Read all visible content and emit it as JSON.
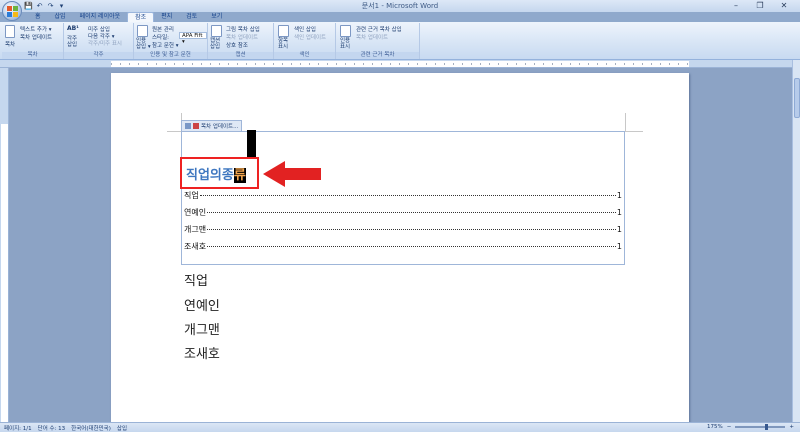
{
  "window": {
    "title": "문서1 - Microsoft Word",
    "minimize": "–",
    "restore": "❐",
    "close": "✕"
  },
  "qat": [
    "💾",
    "↶",
    "↷",
    "▾"
  ],
  "tabs": [
    "홈",
    "삽입",
    "페이지 레이아웃",
    "참조",
    "편지",
    "검토",
    "보기"
  ],
  "active_tab_index": 3,
  "ribbon": {
    "toc_group": {
      "label": "목차",
      "toc_button": "목차",
      "add_text": "텍스트 추가 ▾",
      "update_table": "목차 업데이트"
    },
    "footnote_group": {
      "label": "각주",
      "insert_footnote": "각주\n삽입",
      "insert_endnote": "미주 삽입",
      "next_footnote": "다음 각주 ▾",
      "show_notes": "각주/미주 표시",
      "ab": "AB¹"
    },
    "citation_group": {
      "label": "인용 및 참고 문헌",
      "insert_citation": "인용\n삽입 ▾",
      "manage_sources": "원본 관리",
      "style_label": "스타일:",
      "style_value": "APA Fift ▾",
      "bibliography": "참고 문헌 ▾"
    },
    "caption_group": {
      "label": "캡션",
      "insert_caption": "캡션\n삽입",
      "insert_table_of_figures": "그림 목차 삽입",
      "update_table": "목차 업데이트",
      "cross_reference": "상호 참조"
    },
    "index_group": {
      "label": "색인",
      "mark_entry": "항목\n표시",
      "insert_index": "색인 삽입",
      "update_index": "색인 업데이트"
    },
    "authorities_group": {
      "label": "관련 근거 목차",
      "mark_citation": "인용\n표시",
      "insert_authorities": "관련 근거 목차 삽입",
      "update_authorities": "목차 업데이트"
    }
  },
  "document": {
    "toc_toolbar": {
      "update_label": "목차 업데이트..."
    },
    "toc_title_prefix": "직업의종",
    "toc_title_selected": "류",
    "toc_entries": [
      {
        "label": "직업",
        "page": "1"
      },
      {
        "label": "연예인",
        "page": "1"
      },
      {
        "label": "개그맨",
        "page": "1"
      },
      {
        "label": "조새호",
        "page": "1"
      }
    ],
    "body_lines": [
      "직업",
      "연예인",
      "개그맨",
      "조새호"
    ]
  },
  "statusbar": {
    "page": "페이지: 1/1",
    "words": "단어 수: 13",
    "language": "한국어(대한민국)",
    "mode": "삽입",
    "zoom": "175%",
    "zoom_fraction": 0.63
  },
  "colors": {
    "toc_title": "#3f77c0",
    "selection_text": "#f3a64e",
    "annotation_red": "#e22222"
  }
}
